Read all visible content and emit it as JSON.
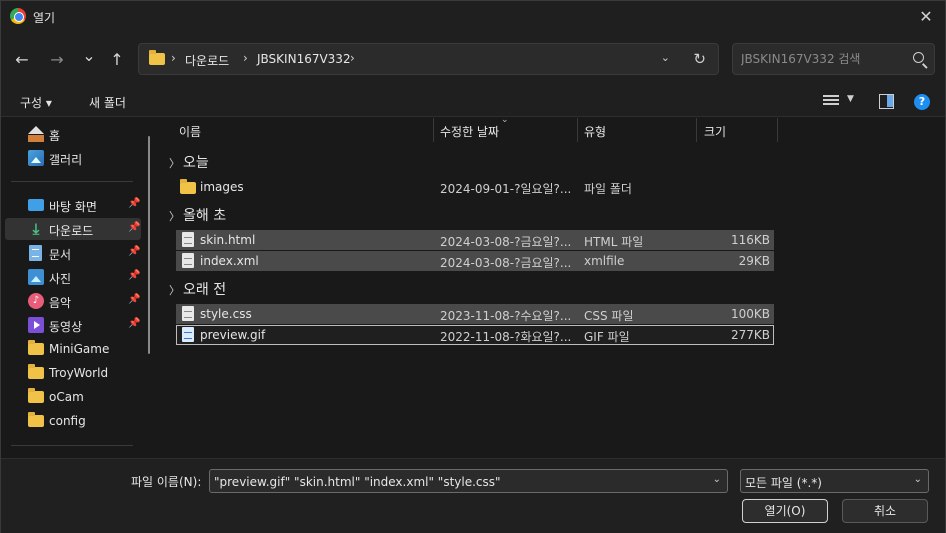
{
  "window": {
    "title": "열기",
    "close": "✕"
  },
  "nav": {
    "back": "←",
    "forward": "→",
    "recent": "⌄",
    "up": "↑",
    "crumbs": [
      "다운로드",
      "JBSKIN167V332"
    ],
    "separator": "›",
    "refresh": "↻",
    "search_placeholder": "JBSKIN167V332 검색"
  },
  "toolbar": {
    "organize": "구성 ▾",
    "new_folder": "새 폴더",
    "help": "?"
  },
  "sidebar": {
    "items": [
      {
        "label": "홈",
        "icon": "home-icon"
      },
      {
        "label": "갤러리",
        "icon": "gallery-icon"
      },
      {
        "label": "바탕 화면",
        "icon": "desktop-icon",
        "pinned": true
      },
      {
        "label": "다운로드",
        "icon": "download-icon",
        "pinned": true,
        "selected": true
      },
      {
        "label": "문서",
        "icon": "document-icon",
        "pinned": true
      },
      {
        "label": "사진",
        "icon": "pictures-icon",
        "pinned": true
      },
      {
        "label": "음악",
        "icon": "music-icon",
        "pinned": true
      },
      {
        "label": "동영상",
        "icon": "video-icon",
        "pinned": true
      },
      {
        "label": "MiniGame",
        "icon": "folder-icon"
      },
      {
        "label": "TroyWorld",
        "icon": "folder-icon"
      },
      {
        "label": "oCam",
        "icon": "folder-icon"
      },
      {
        "label": "config",
        "icon": "folder-icon"
      }
    ]
  },
  "columns": {
    "name": "이름",
    "modified": "수정한 날짜",
    "type": "유형",
    "size": "크기"
  },
  "groups": [
    {
      "label": "오늘",
      "files": [
        {
          "name": "images",
          "modified": "2024-09-01-?일요일?...",
          "type": "파일 폴더",
          "size": "",
          "kind": "folder"
        }
      ]
    },
    {
      "label": "올해 초",
      "files": [
        {
          "name": "skin.html",
          "modified": "2024-03-08-?금요일?...",
          "type": "HTML 파일",
          "size": "116KB",
          "kind": "file",
          "selected": true
        },
        {
          "name": "index.xml",
          "modified": "2024-03-08-?금요일?...",
          "type": "xmlfile",
          "size": "29KB",
          "kind": "file",
          "selected": true
        }
      ]
    },
    {
      "label": "오래 전",
      "files": [
        {
          "name": "style.css",
          "modified": "2023-11-08-?수요일?...",
          "type": "CSS 파일",
          "size": "100KB",
          "kind": "file",
          "selected": true
        },
        {
          "name": "preview.gif",
          "modified": "2022-11-08-?화요일?...",
          "type": "GIF 파일",
          "size": "277KB",
          "kind": "gif",
          "focused": true
        }
      ]
    }
  ],
  "footer": {
    "filename_label": "파일 이름(N):",
    "filename_value": "\"preview.gif\" \"skin.html\" \"index.xml\" \"style.css\"",
    "filetype": "모든 파일 (*.*)",
    "open": "열기(O)",
    "cancel": "취소"
  },
  "colors": {
    "accent": "#1f8ef1",
    "folder": "#f0c348",
    "selection": "#4a4a4a"
  }
}
